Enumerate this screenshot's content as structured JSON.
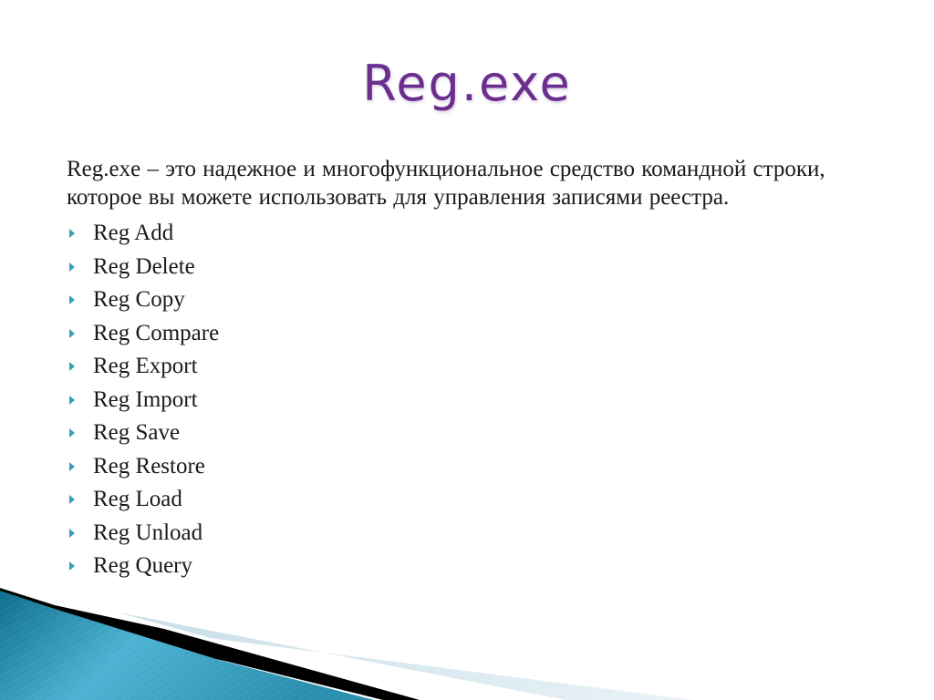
{
  "slide": {
    "title": "Reg.exe",
    "intro": "Reg.exe – это надежное и многофункциональное  средство командной строки, которое вы можете использовать для управления записями реестра.",
    "bullet_icon": "triangle-right-icon",
    "bullets": [
      {
        "label": "Reg Add"
      },
      {
        "label": "Reg Delete"
      },
      {
        "label": "Reg Copy"
      },
      {
        "label": "Reg Compare"
      },
      {
        "label": "Reg Export"
      },
      {
        "label": "Reg Import"
      },
      {
        "label": "Reg Save"
      },
      {
        "label": "Reg Restore"
      },
      {
        "label": "Reg Load"
      },
      {
        "label": "Reg Unload"
      },
      {
        "label": "Reg Query"
      }
    ]
  },
  "colors": {
    "title": "#6b2f8f",
    "text": "#1a1a1a",
    "bullet": "#3a9fb3",
    "swoosh_blue_dark": "#0e6e8c",
    "swoosh_blue_light": "#4cb3d3",
    "swoosh_black": "#000000",
    "swoosh_pale": "#d4e6ef",
    "background": "#ffffff"
  }
}
